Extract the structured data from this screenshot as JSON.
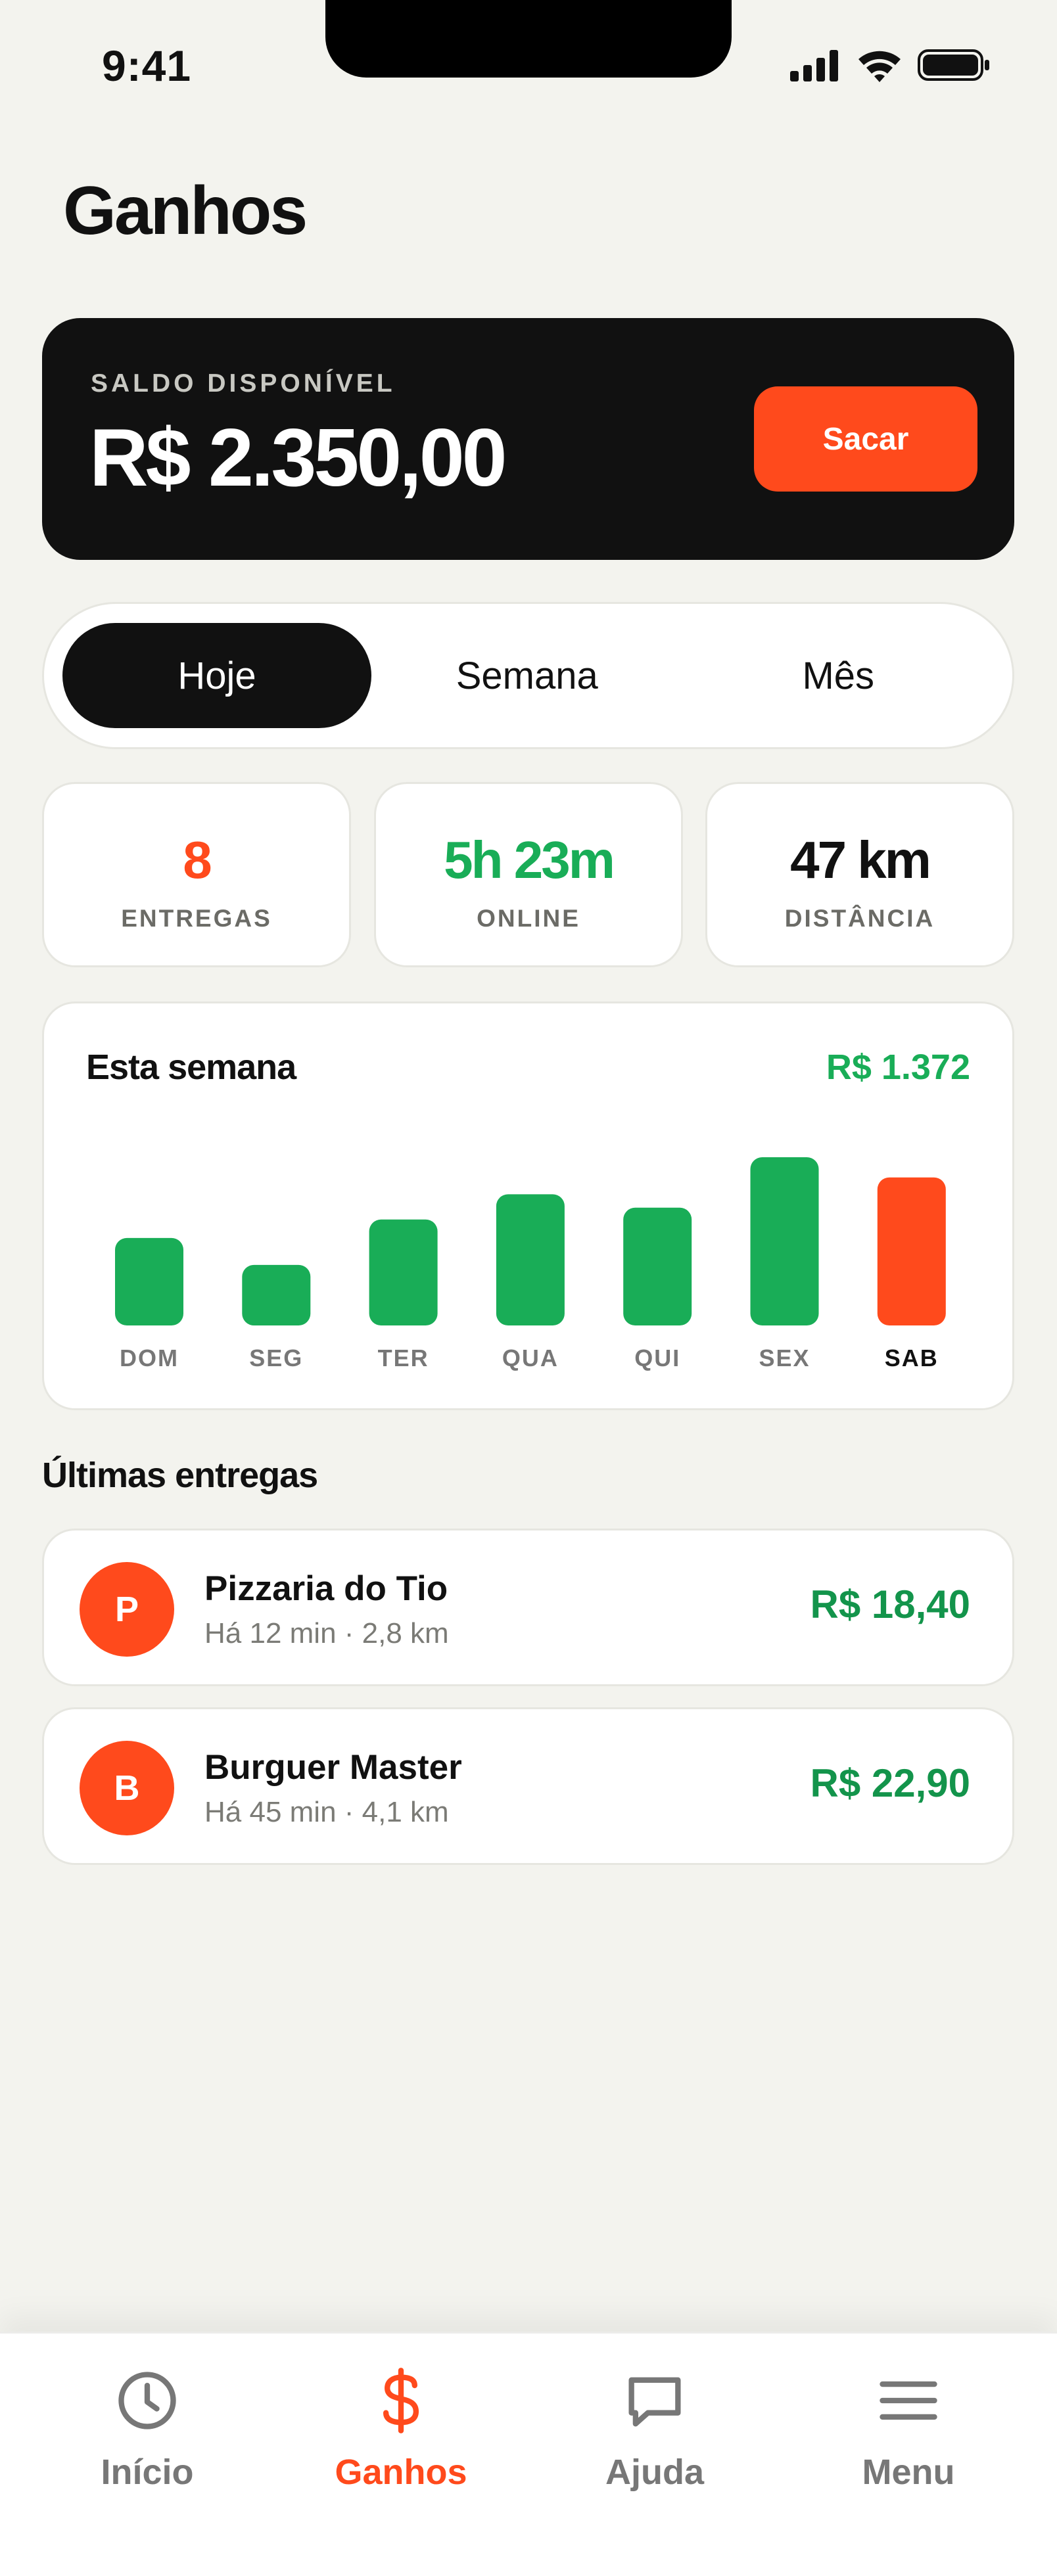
{
  "status_bar": {
    "time": "9:41"
  },
  "page": {
    "title": "Ganhos"
  },
  "balance": {
    "label": "SALDO DISPONÍVEL",
    "amount": "R$ 2.350,00",
    "action_label": "Sacar"
  },
  "period_tabs": [
    {
      "label": "Hoje",
      "active": true
    },
    {
      "label": "Semana",
      "active": false
    },
    {
      "label": "Mês",
      "active": false
    }
  ],
  "stats": [
    {
      "value": "8",
      "label": "ENTREGAS",
      "color": "#ff4a1c"
    },
    {
      "value": "5h 23m",
      "label": "ONLINE",
      "color": "#19ad57"
    },
    {
      "value": "47 km",
      "label": "DISTÂNCIA",
      "color": "#111111"
    }
  ],
  "week": {
    "title": "Esta semana",
    "total": "R$ 1.372"
  },
  "chart_data": {
    "type": "bar",
    "categories": [
      "DOM",
      "SEG",
      "TER",
      "QUA",
      "QUI",
      "SEX",
      "SAB"
    ],
    "values": [
      52,
      36,
      63,
      78,
      70,
      100,
      88
    ],
    "highlighted_category": "SAB",
    "colors": {
      "default": "#19ad57",
      "highlight": "#ff4a1c"
    },
    "title": "Esta semana"
  },
  "recent": {
    "title": "Últimas entregas",
    "items": [
      {
        "initial": "P",
        "name": "Pizzaria do Tio",
        "meta": "Há 12 min · 2,8 km",
        "amount": "R$ 18,40"
      },
      {
        "initial": "B",
        "name": "Burguer Master",
        "meta": "Há 45 min · 4,1 km",
        "amount": "R$ 22,90"
      }
    ]
  },
  "bottom_nav": [
    {
      "label": "Início",
      "icon": "clock-icon",
      "active": false
    },
    {
      "label": "Ganhos",
      "icon": "dollar-icon",
      "active": true
    },
    {
      "label": "Ajuda",
      "icon": "chat-bubble-icon",
      "active": false
    },
    {
      "label": "Menu",
      "icon": "menu-icon",
      "active": false
    }
  ],
  "colors": {
    "accent": "#ff4a1c",
    "positive": "#19ad57",
    "background": "#f3f3ee",
    "dark": "#111111"
  }
}
